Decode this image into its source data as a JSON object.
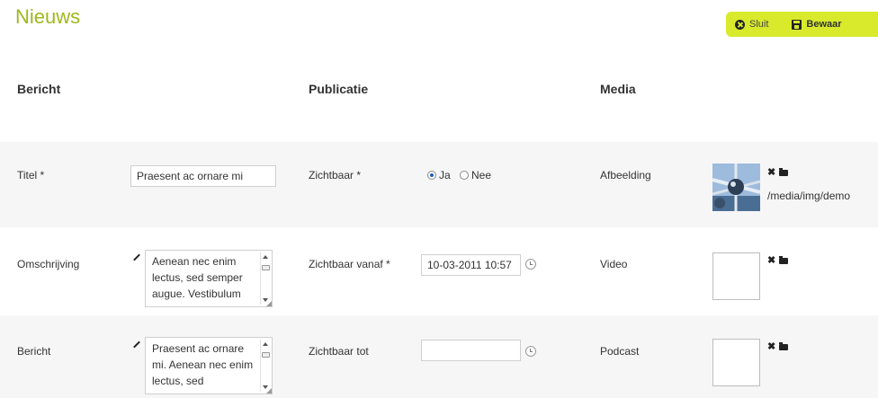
{
  "page": {
    "title": "Nieuws"
  },
  "toolbar": {
    "close_label": "Sluit",
    "save_label": "Bewaar",
    "color": "#d8ea2b"
  },
  "columns": {
    "bericht": "Bericht",
    "publicatie": "Publicatie",
    "media": "Media"
  },
  "fields": {
    "titel": {
      "label": "Titel *",
      "value": "Praesent ac ornare mi"
    },
    "omschrijving": {
      "label": "Omschrijving",
      "value": "Aenean nec enim lectus, sed semper augue. Vestibulum"
    },
    "bericht": {
      "label": "Bericht",
      "value": "Praesent ac ornare mi. Aenean nec enim lectus, sed"
    }
  },
  "publicatie": {
    "zichtbaar": {
      "label": "Zichtbaar *",
      "options": [
        "Ja",
        "Nee"
      ],
      "selected": "Ja"
    },
    "vanaf": {
      "label": "Zichtbaar vanaf *",
      "value": "10-03-2011 10:57"
    },
    "tot": {
      "label": "Zichtbaar tot",
      "value": ""
    }
  },
  "media": {
    "afbeelding": {
      "label": "Afbeelding",
      "path": "/media/img/demo"
    },
    "video": {
      "label": "Video"
    },
    "podcast": {
      "label": "Podcast"
    }
  },
  "icons": {
    "close": "close-circle-icon",
    "save": "floppy-disk-icon",
    "edit": "pencil-icon",
    "clock": "clock-icon",
    "remove": "x-icon",
    "browse": "folder-open-icon"
  },
  "colors": {
    "title": "#9fb81d",
    "row_shade": "#f6f6f6"
  }
}
